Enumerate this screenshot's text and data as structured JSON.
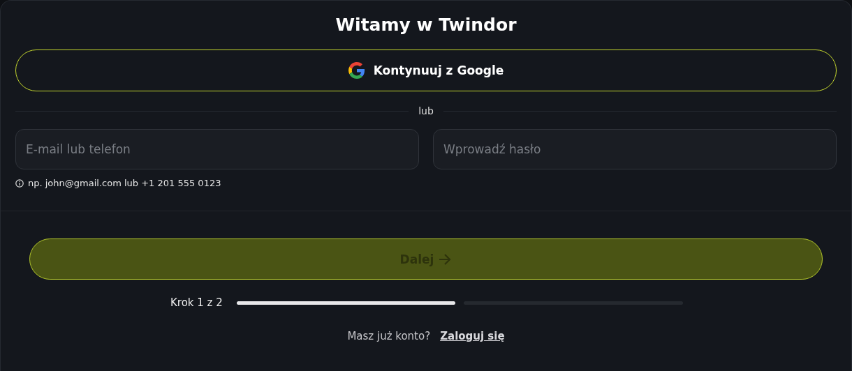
{
  "title": "Witamy w Twindor",
  "google_button": {
    "label": "Kontynuuj z Google"
  },
  "divider": {
    "label": "lub"
  },
  "fields": [
    {
      "placeholder": "E-mail lub telefon"
    },
    {
      "placeholder": "Wprowadź hasło"
    }
  ],
  "hint": "np. john@gmail.com lub +1 201 555 0123",
  "next_button": {
    "label": "Dalej",
    "disabled": true
  },
  "progress": {
    "label": "Krok 1 z 2",
    "segments": [
      {
        "filled": true
      },
      {
        "filled": false
      }
    ]
  },
  "footer": {
    "text": "Masz już konto?",
    "link": "Zaloguj się"
  }
}
